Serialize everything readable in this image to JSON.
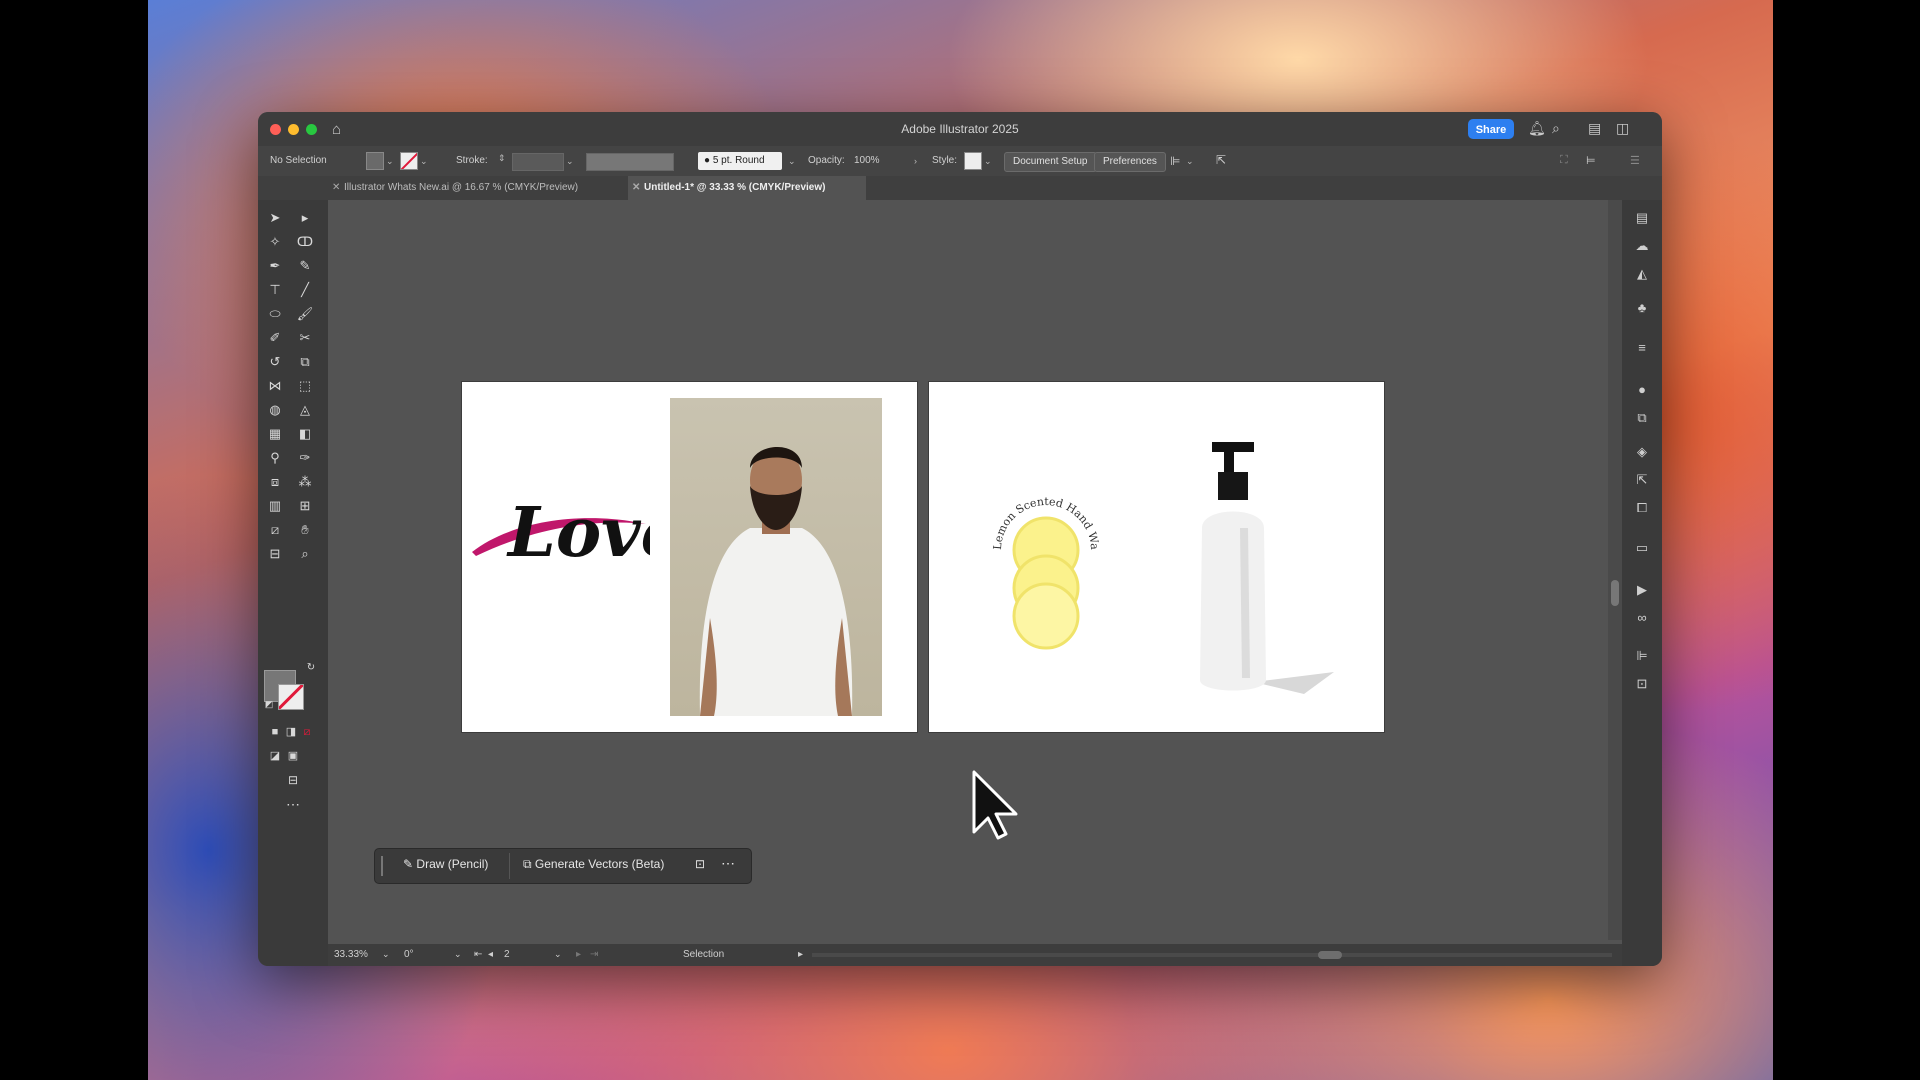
{
  "app": {
    "title": "Adobe Illustrator 2025",
    "share_label": "Share"
  },
  "control_bar": {
    "selection_status": "No Selection",
    "stroke_label": "Stroke:",
    "brush_label": "5 pt. Round",
    "opacity_label": "Opacity:",
    "opacity_value": "100%",
    "style_label": "Style:",
    "document_setup_label": "Document Setup",
    "preferences_label": "Preferences"
  },
  "tabs": [
    {
      "label": "Illustrator Whats New.ai @ 16.67 % (CMYK/Preview)",
      "active": false
    },
    {
      "label": "Untitled-1* @ 33.33 % (CMYK/Preview)",
      "active": true
    }
  ],
  "artboards": {
    "left": {
      "lettering": "Love"
    },
    "right": {
      "label_text": "Lemon Scented Hand Wash"
    }
  },
  "context_bar": {
    "draw_label": "Draw (Pencil)",
    "generate_label": "Generate Vectors (Beta)"
  },
  "status_bar": {
    "zoom": "33.33%",
    "rotation": "0°",
    "artboard_number": "2",
    "tool": "Selection"
  },
  "colors": {
    "accent": "#2d7ff0",
    "swash": "#c0176b",
    "none_slash": "#e0193a"
  }
}
